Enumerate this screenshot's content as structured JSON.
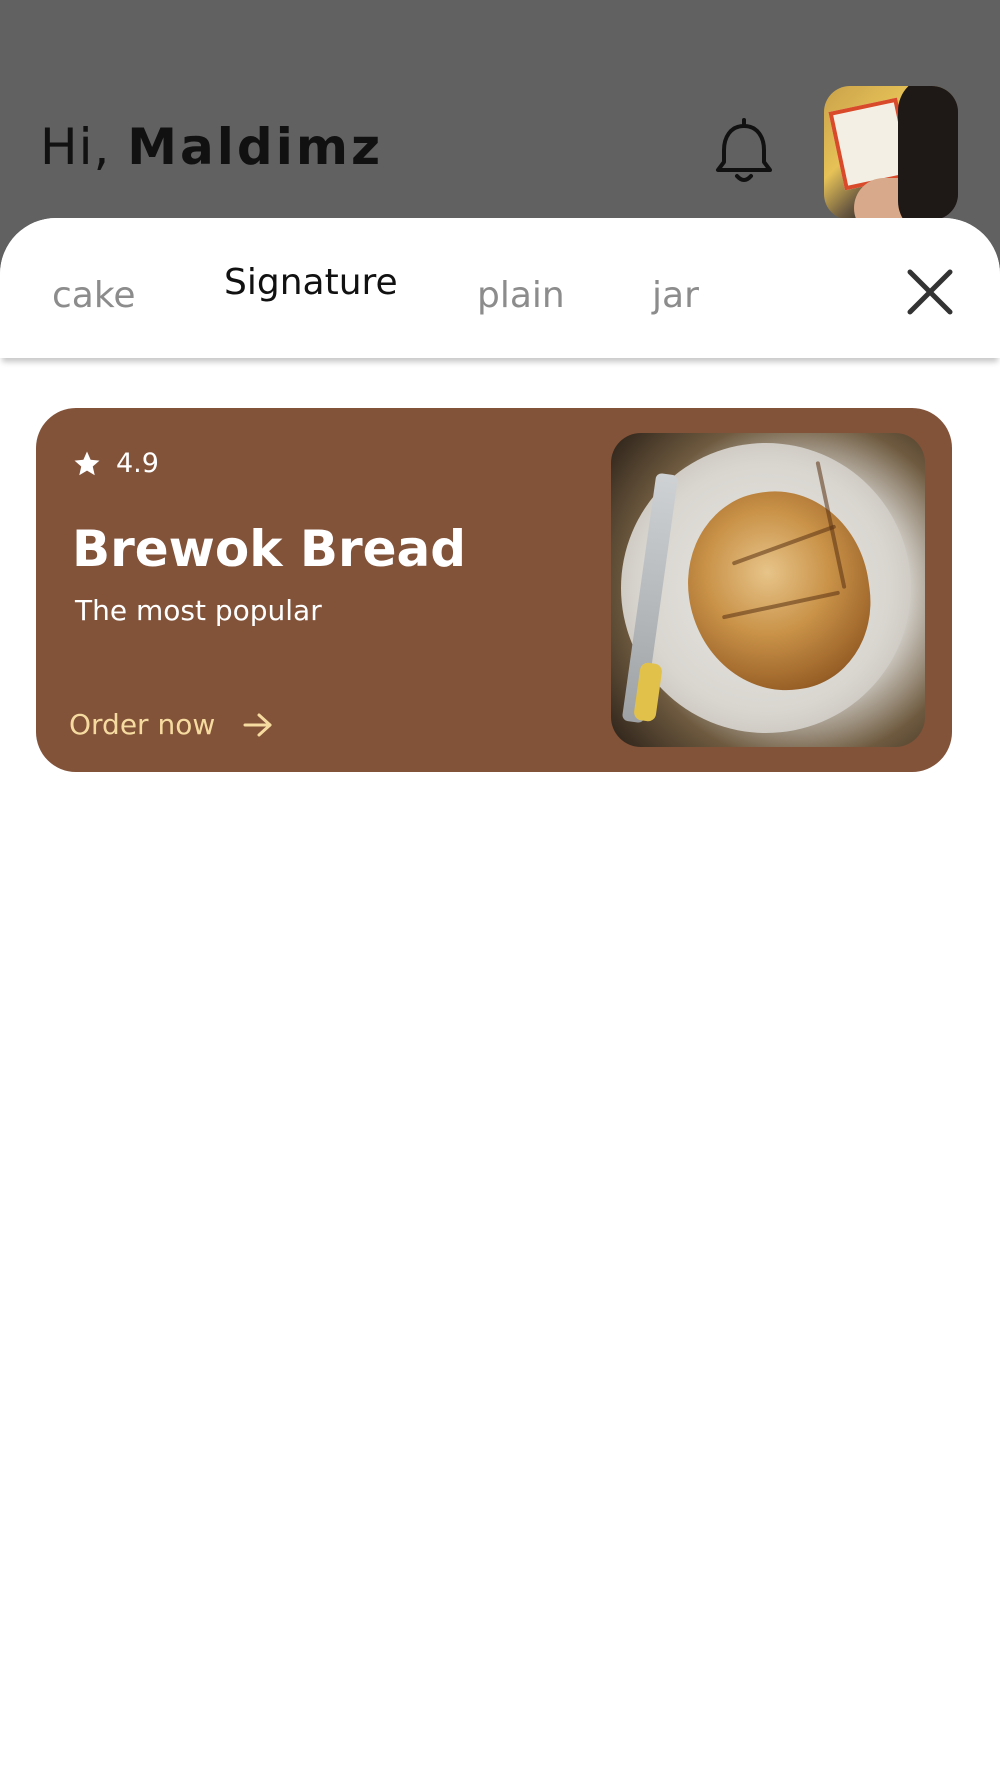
{
  "header": {
    "greeting_prefix": "Hi,",
    "user_name": "Maldimz",
    "bell_icon": "bell-icon",
    "avatar_icon": "avatar"
  },
  "tabs": [
    {
      "label": "cake",
      "active": false
    },
    {
      "label": "Signature",
      "active": true
    },
    {
      "label": "plain",
      "active": false
    },
    {
      "label": "jar",
      "active": false
    }
  ],
  "close_icon": "close-icon",
  "product_card": {
    "rating": "4.9",
    "title": "Brewok Bread",
    "subtitle": "The most popular",
    "cta_label": "Order now",
    "image_icon": "bread-photo"
  },
  "colors": {
    "overlay": "#616161",
    "card_background": "#825239",
    "cta_text": "#f6dba0",
    "tab_inactive": "#8c8c8c",
    "tab_active": "#111111"
  }
}
